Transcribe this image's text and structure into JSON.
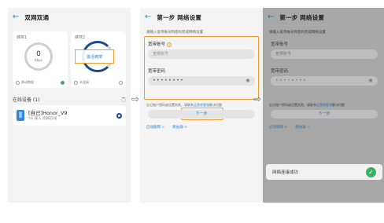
{
  "screen1": {
    "title": "双网双通",
    "card1_label": "蜂窝1",
    "card1_value": "0",
    "card1_unit": "Kbps",
    "card1_option": "移动数据",
    "card2_label": "蜂窝2",
    "card2_button": "激活蜂窝",
    "card2_option": "未连接",
    "online_section": "在线设备 (1)",
    "device_name": "[自己]Honor_V9",
    "device_sub": "5G 接入  刚刚在线",
    "accent": "#2f86d6"
  },
  "arrow_glyph": "⇨",
  "screen2": {
    "title": "第一步 网络设置",
    "hint": "请输入宽带账号和密码完成网络设置",
    "account_label": "宽带账号",
    "account_placeholder": "宽带账号",
    "password_label": "宽带密码",
    "password_value": "••••••••",
    "note_text": "忘记账户密码或设置失败，请联系",
    "note_link": "运营商客服",
    "note_tail": "解决问题",
    "next_button": "下一步",
    "link1": "启动联网 >",
    "link2": "路由器 >",
    "highlight": "#f29d2b"
  },
  "screen3": {
    "title": "第一步 网络设置",
    "hint": "请输入宽带账号和密码完成网络设置",
    "account_label": "宽带账号",
    "account_placeholder": "宽带账号",
    "password_label": "宽带密码",
    "password_value": "••••••••",
    "note_text": "忘记账户密码或设置失败，请联系",
    "note_link": "运营商客服",
    "note_tail": "解决问题",
    "next_button": "下一步",
    "link1": "启动联网 >",
    "link2": "路由器 >",
    "toast": "网络连接成功",
    "toast_icon": "✓"
  }
}
